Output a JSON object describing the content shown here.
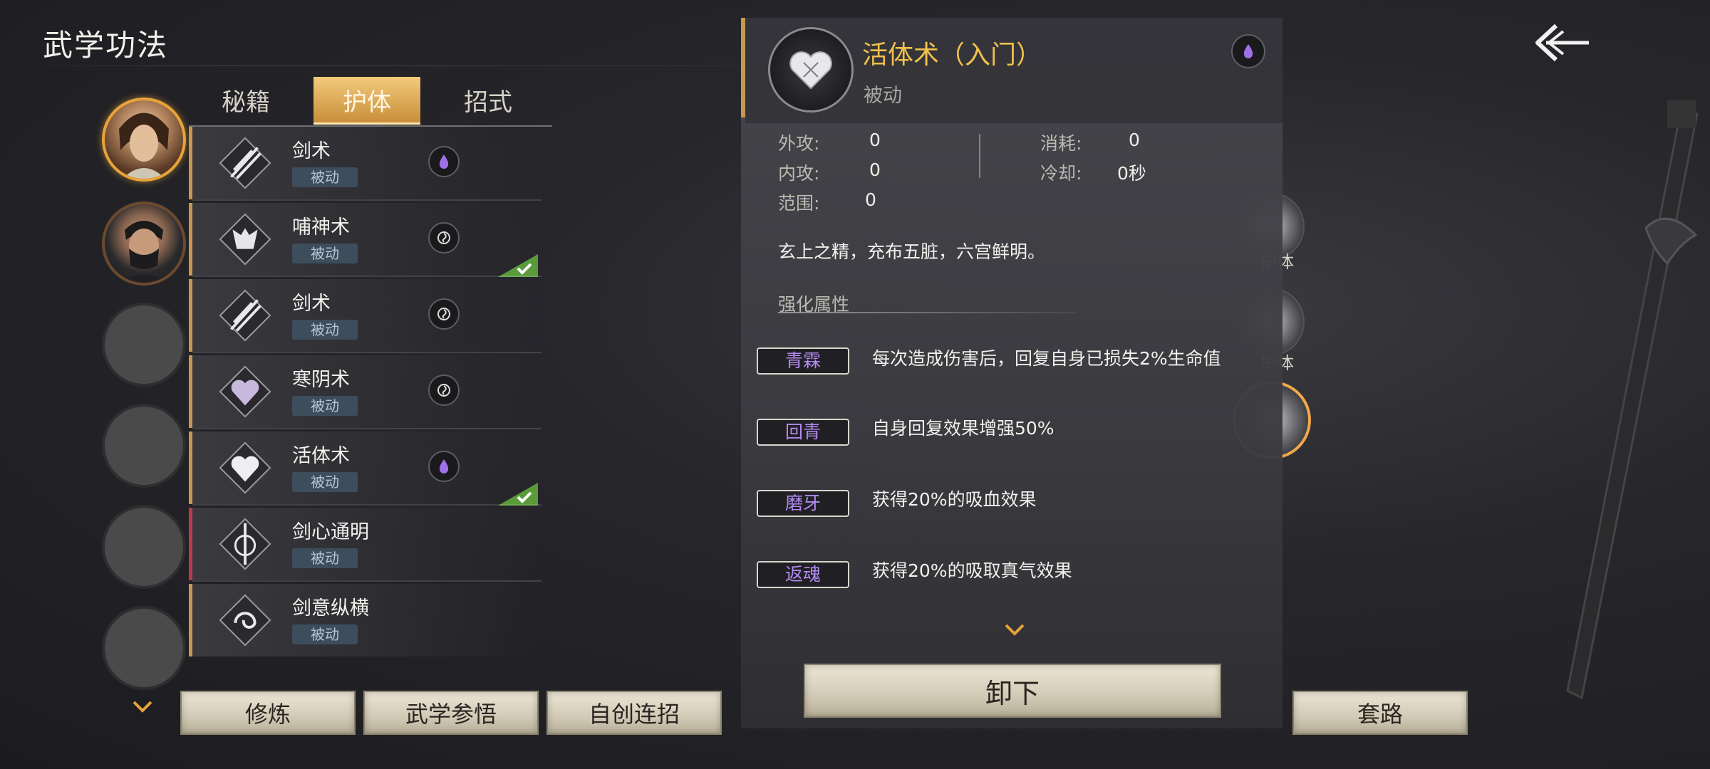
{
  "header": {
    "title": "武学功法"
  },
  "tabs": [
    {
      "label": "秘籍",
      "active": false
    },
    {
      "label": "护体",
      "active": true
    },
    {
      "label": "招式",
      "active": false
    }
  ],
  "skills": [
    {
      "name": "剑术",
      "badge": "被动",
      "gem": "purple",
      "equipped": false,
      "marker": "gold"
    },
    {
      "name": "哺神术",
      "badge": "被动",
      "gem": "dark",
      "equipped": true,
      "marker": "gold"
    },
    {
      "name": "剑术",
      "badge": "被动",
      "gem": "dark",
      "equipped": false,
      "marker": "gold"
    },
    {
      "name": "寒阴术",
      "badge": "被动",
      "gem": "dark",
      "equipped": false,
      "marker": "gold"
    },
    {
      "name": "活体术",
      "badge": "被动",
      "gem": "purple",
      "equipped": true,
      "marker": "gold"
    },
    {
      "name": "剑心通明",
      "badge": "被动",
      "gem": null,
      "equipped": false,
      "marker": "red"
    },
    {
      "name": "剑意纵横",
      "badge": "被动",
      "gem": null,
      "equipped": false,
      "marker": "gold"
    }
  ],
  "detail": {
    "name": "活体术（入门）",
    "type": "被动",
    "stats": {
      "outer_attack_label": "外攻:",
      "outer_attack": "0",
      "inner_attack_label": "内攻:",
      "inner_attack": "0",
      "range_label": "范围:",
      "range": "0",
      "cost_label": "消耗:",
      "cost": "0",
      "cooldown_label": "冷却:",
      "cooldown": "0秒"
    },
    "description": "玄上之精，充布五脏，六宫鲜明。",
    "enhance_title": "强化属性",
    "enhancements": [
      {
        "tag": "青霖",
        "text": "每次造成伤害后，回复自身已损失2%生命值"
      },
      {
        "tag": "回青",
        "text": "自身回复效果增强50%"
      },
      {
        "tag": "磨牙",
        "text": "获得20%的吸血效果"
      },
      {
        "tag": "返魂",
        "text": "获得20%的吸取真气效果"
      }
    ],
    "unload_label": "卸下"
  },
  "side_slots": [
    {
      "label": "护体"
    },
    {
      "label": "护体"
    },
    {
      "label": ""
    }
  ],
  "buttons": {
    "cultivate": "修炼",
    "comprehend": "武学参悟",
    "custom_combo": "自创连招",
    "routine": "套路"
  },
  "colors": {
    "accent_gold": "#e8a33a",
    "skill_title_gold": "#f1c14b",
    "enhance_purple": "#b48af0",
    "check_green": "#5a9a3a"
  }
}
